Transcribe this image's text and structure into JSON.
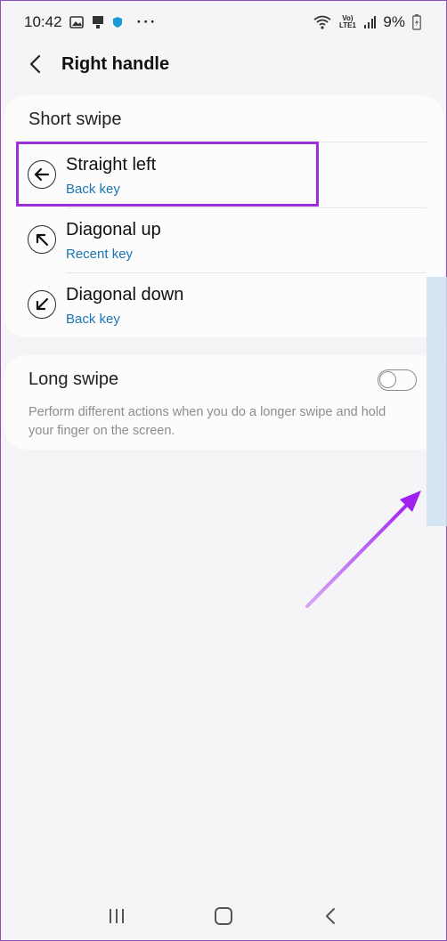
{
  "status_bar": {
    "time": "10:42",
    "battery_percent": "9%",
    "left_icons": [
      "image-icon",
      "cast-icon",
      "shield-icon",
      "more-dots-icon"
    ],
    "right_icons": [
      "wifi-icon",
      "volte-icon",
      "signal-icon",
      "battery-charging-icon"
    ],
    "volte_label": "Vo) LTE1"
  },
  "header": {
    "title": "Right handle"
  },
  "short_swipe": {
    "section_label": "Short swipe",
    "options": [
      {
        "title": "Straight left",
        "subtitle": "Back key",
        "icon": "arrow-left-icon"
      },
      {
        "title": "Diagonal up",
        "subtitle": "Recent key",
        "icon": "arrow-up-left-icon"
      },
      {
        "title": "Diagonal down",
        "subtitle": "Back key",
        "icon": "arrow-down-left-icon"
      }
    ]
  },
  "long_swipe": {
    "title": "Long swipe",
    "description": "Perform different actions when you do a longer swipe and hold your finger on the screen.",
    "enabled": false
  },
  "colors": {
    "accent_link": "#1976b3",
    "highlight": "#9b30d9",
    "annotation_arrow": "#a020f0",
    "background": "#f5f4f6"
  },
  "nav_bar": {
    "icons": [
      "recents-icon",
      "home-icon",
      "back-icon"
    ]
  }
}
